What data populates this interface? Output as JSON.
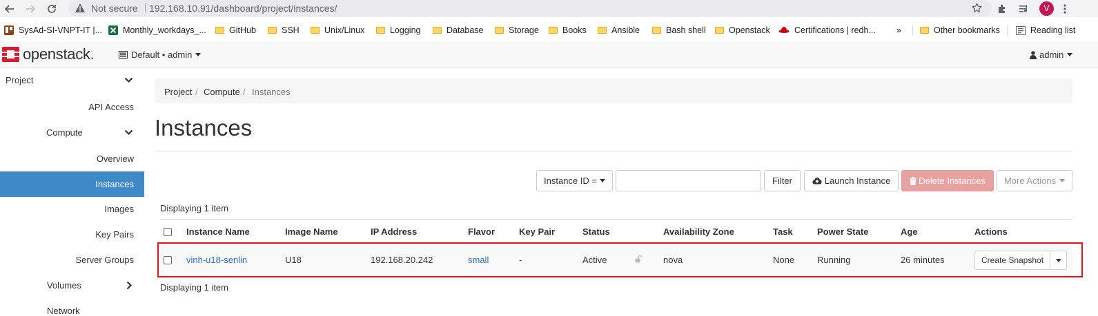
{
  "browser": {
    "not_secure": "Not secure",
    "url": "192.168.10.91/dashboard/project/instances/",
    "profile_initial": "V",
    "bookmarks": [
      {
        "label": "SysAd-SI-VNPT-IT |...",
        "icon": "trello-icon"
      },
      {
        "label": "Monthly_workdays_...",
        "icon": "excel-icon"
      },
      {
        "label": "GitHub",
        "icon": "folder-icon"
      },
      {
        "label": "SSH",
        "icon": "folder-icon"
      },
      {
        "label": "Unix/Linux",
        "icon": "folder-icon"
      },
      {
        "label": "Logging",
        "icon": "folder-icon"
      },
      {
        "label": "Database",
        "icon": "folder-icon"
      },
      {
        "label": "Storage",
        "icon": "folder-icon"
      },
      {
        "label": "Books",
        "icon": "folder-icon"
      },
      {
        "label": "Ansible",
        "icon": "folder-icon"
      },
      {
        "label": "Bash shell",
        "icon": "folder-icon"
      },
      {
        "label": "Openstack",
        "icon": "folder-icon"
      },
      {
        "label": "Certifications | redh...",
        "icon": "redhat-icon"
      }
    ],
    "overflow": "»",
    "other_bookmarks": "Other bookmarks",
    "reading_list": "Reading list"
  },
  "topnav": {
    "logo": "openstack",
    "logo_mark": ".",
    "project_selector": "Default • admin",
    "user": "admin"
  },
  "sidebar": {
    "project": "Project",
    "api_access": "API Access",
    "compute": "Compute",
    "overview": "Overview",
    "instances": "Instances",
    "images": "Images",
    "key_pairs": "Key Pairs",
    "server_groups": "Server Groups",
    "volumes": "Volumes",
    "network": "Network"
  },
  "breadcrumb": {
    "project": "Project",
    "compute": "Compute",
    "instances": "Instances",
    "separator": "/"
  },
  "page_title": "Instances",
  "toolbar": {
    "filter_field": "Instance ID =",
    "search_value": "",
    "filter_button": "Filter",
    "launch_button": "Launch Instance",
    "delete_button": "Delete Instances",
    "more_actions": "More Actions"
  },
  "displaying_top": "Displaying 1 item",
  "displaying_bottom": "Displaying 1 item",
  "table": {
    "headers": [
      "Instance Name",
      "Image Name",
      "IP Address",
      "Flavor",
      "Key Pair",
      "Status",
      "Availability Zone",
      "Task",
      "Power State",
      "Age",
      "Actions"
    ],
    "rows": [
      {
        "instance_name": "vinh-u18-senlin",
        "image_name": "U18",
        "ip_address": "192.168.20.242",
        "flavor": "small",
        "key_pair": "-",
        "status": "Active",
        "availability_zone": "nova",
        "task": "None",
        "power_state": "Running",
        "age": "26 minutes",
        "action": "Create Snapshot"
      }
    ]
  },
  "colors": {
    "accent": "#3f89c9",
    "link": "#2a6ebb",
    "danger_button": "#e7a19f",
    "highlight_border": "#e8121c",
    "logo_red": "#da1a32"
  }
}
